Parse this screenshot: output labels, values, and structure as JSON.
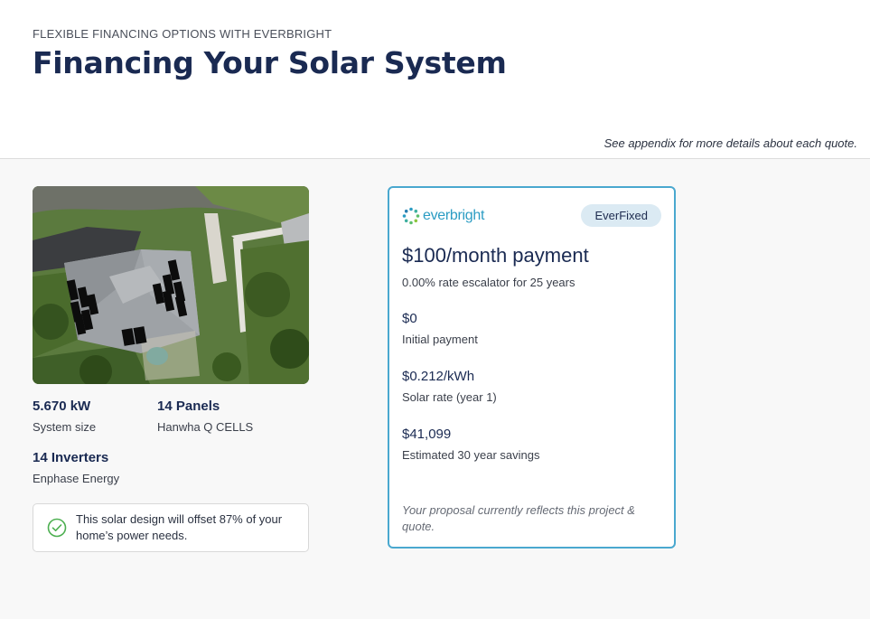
{
  "header": {
    "eyebrow": "FLEXIBLE FINANCING OPTIONS WITH EVERBRIGHT",
    "title": "Financing Your Solar System",
    "appendix_note": "See appendix for more details about each quote."
  },
  "system": {
    "image_icon": "aerial-roof-image",
    "specs": [
      {
        "value": "5.670 kW",
        "label": "System size"
      },
      {
        "value": "14 Panels",
        "label": "Hanwha Q CELLS"
      },
      {
        "value": "14 Inverters",
        "label": "Enphase Energy"
      }
    ],
    "offset": {
      "icon": "check-circle-icon",
      "text": "This solar design will offset 87% of your home’s power needs."
    }
  },
  "quote": {
    "brand": "everbright",
    "brand_icon": "everbright-logo-icon",
    "badge": "EverFixed",
    "payment": "$100/month payment",
    "escalator": "0.00% rate escalator for 25 years",
    "rows": [
      {
        "value": "$0",
        "label": "Initial payment"
      },
      {
        "value": "$0.212/kWh",
        "label": "Solar rate (year 1)"
      },
      {
        "value": "$41,099",
        "label": "Estimated 30 year savings"
      }
    ],
    "note": "Your proposal currently reflects this project & quote."
  },
  "colors": {
    "accent": "#4aa8cf",
    "brand": "#2b9cc3",
    "badge_bg": "#dbeaf3",
    "title": "#1a2a52",
    "check": "#4caf50"
  }
}
